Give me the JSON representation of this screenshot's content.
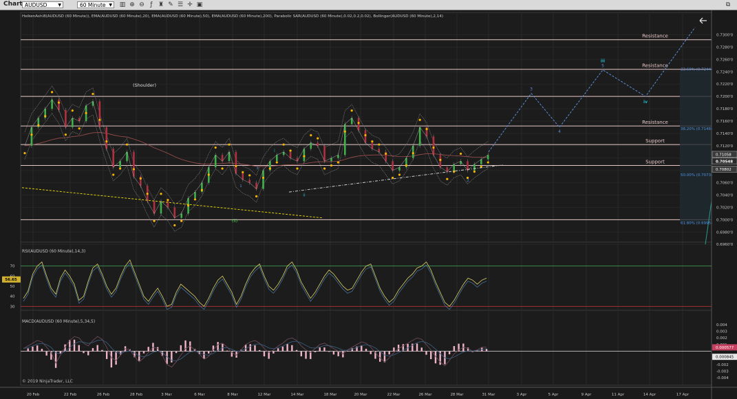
{
  "toolbar": {
    "title": "Chart",
    "instrument": "AUDUSD",
    "interval": "60 Minute"
  },
  "panels": {
    "price_header": "HeikenAshi8(AUDUSD (60 Minute)), EMA(AUDUSD (60 Minute),20), EMA(AUDUSD (60 Minute),50), EMA(AUDUSD (60 Minute),200), Parabolic SAR(AUDUSD (60 Minute),0.02,0.2,0.02), Bollinger(AUDUSD (60 Minute),2,14)",
    "rsi_header": "RSI(AUDUSD (60 Minute),14,3)",
    "macd_header": "MACD(AUDUSD (60 Minute),5,34,5)",
    "copyright": "© 2019 NinjaTrader, LLC"
  },
  "colors": {
    "background": "#1a1a1a",
    "horizontal_lines": "#e8c8c8",
    "sar": "#f5b400",
    "wave_projection": "#5b8fd6",
    "wave_label_cyan": "#1fb8c8",
    "fib_text": "#4f8fe0",
    "trendline_yellow": "#e0d000",
    "trendline_white": "#d0d0d0",
    "rsi_line": "#c8c060",
    "rsi_top": "#3a8a4a",
    "rsi_bottom": "#a03030",
    "macd_hist": "#f0b4c8"
  },
  "chart_data": [
    {
      "type": "line",
      "name": "price",
      "x_tick_labels": [
        "20 Feb",
        "22 Feb",
        "26 Feb",
        "28 Feb",
        "3 Mar",
        "6 Mar",
        "8 Mar",
        "12 Mar",
        "14 Mar",
        "18 Mar",
        "20 Mar",
        "22 Mar",
        "26 Mar",
        "28 Mar",
        "31 Mar",
        "3 Apr",
        "5 Apr",
        "9 Apr",
        "11 Apr",
        "14 Apr",
        "17 Apr"
      ],
      "y_tick_labels": [
        "0.7300'0",
        "0.7280'0",
        "0.7260'0",
        "0.7240'0",
        "0.7220'0",
        "0.7200'0",
        "0.7180'0",
        "0.7160'0",
        "0.7140'0",
        "0.7120'0",
        "0.7100'0",
        "0.7080'0",
        "0.7060'0",
        "0.7040'0",
        "0.7020'0",
        "0.7000'0",
        "0.6980'0",
        "0.6960'0"
      ],
      "ylim": [
        0.6948,
        0.7314
      ],
      "price_path": [
        [
          0,
          0.712
        ],
        [
          3,
          0.715
        ],
        [
          6,
          0.7165
        ],
        [
          9,
          0.718
        ],
        [
          12,
          0.7195
        ],
        [
          15,
          0.7178
        ],
        [
          18,
          0.715
        ],
        [
          21,
          0.7165
        ],
        [
          24,
          0.716
        ],
        [
          27,
          0.7185
        ],
        [
          30,
          0.7192
        ],
        [
          33,
          0.715
        ],
        [
          36,
          0.7115
        ],
        [
          39,
          0.7085
        ],
        [
          42,
          0.7095
        ],
        [
          45,
          0.711
        ],
        [
          48,
          0.707
        ],
        [
          51,
          0.7055
        ],
        [
          54,
          0.703
        ],
        [
          57,
          0.701
        ],
        [
          60,
          0.703
        ],
        [
          63,
          0.702
        ],
        [
          66,
          0.7003
        ],
        [
          69,
          0.701
        ],
        [
          72,
          0.7035
        ],
        [
          75,
          0.7045
        ],
        [
          78,
          0.706
        ],
        [
          81,
          0.7085
        ],
        [
          84,
          0.7105
        ],
        [
          87,
          0.7095
        ],
        [
          90,
          0.711
        ],
        [
          93,
          0.7075
        ],
        [
          96,
          0.7065
        ],
        [
          99,
          0.706
        ],
        [
          102,
          0.705
        ],
        [
          105,
          0.708
        ],
        [
          108,
          0.7095
        ],
        [
          111,
          0.7105
        ],
        [
          114,
          0.711
        ],
        [
          117,
          0.71
        ],
        [
          120,
          0.7095
        ],
        [
          123,
          0.7115
        ],
        [
          126,
          0.7125
        ],
        [
          129,
          0.712
        ],
        [
          132,
          0.7095
        ],
        [
          135,
          0.71
        ],
        [
          138,
          0.7105
        ],
        [
          141,
          0.7155
        ],
        [
          144,
          0.7165
        ],
        [
          147,
          0.7145
        ],
        [
          150,
          0.7125
        ],
        [
          153,
          0.7115
        ],
        [
          156,
          0.711
        ],
        [
          159,
          0.7095
        ],
        [
          162,
          0.708
        ],
        [
          165,
          0.7085
        ],
        [
          168,
          0.71
        ],
        [
          171,
          0.712
        ],
        [
          174,
          0.715
        ],
        [
          177,
          0.7135
        ],
        [
          180,
          0.7105
        ],
        [
          183,
          0.7085
        ],
        [
          186,
          0.7078
        ],
        [
          189,
          0.709
        ],
        [
          192,
          0.7095
        ],
        [
          195,
          0.708
        ],
        [
          198,
          0.709
        ],
        [
          201,
          0.7098
        ],
        [
          204,
          0.7105
        ]
      ],
      "horizontal_levels": [
        {
          "value": 0.7292,
          "label": "Resistance"
        },
        {
          "value": 0.7244,
          "label": "Resistance"
        },
        {
          "value": 0.72,
          "label": ""
        },
        {
          "value": 0.7152,
          "label": "Resistance"
        },
        {
          "value": 0.7122,
          "label": "Support"
        },
        {
          "value": 0.7088,
          "label": "Support"
        },
        {
          "value": 0.7,
          "label": ""
        }
      ],
      "fib_labels": [
        {
          "value": 0.7244,
          "text": "23.60% (0.7244)"
        },
        {
          "value": 0.7148,
          "text": "38.20% (0.7148)"
        },
        {
          "value": 0.7073,
          "text": "50.00% (0.7073)"
        },
        {
          "value": 0.6995,
          "text": "61.80% (0.6995)"
        }
      ],
      "price_badges": [
        "0.71058",
        "0.70548",
        "0.70802"
      ],
      "projection": [
        {
          "date": "31 Mar",
          "value": 0.711,
          "label": ""
        },
        {
          "date": "3 Apr",
          "value": 0.7205,
          "label": "3"
        },
        {
          "date": "5 Apr",
          "value": 0.715,
          "label": "4"
        },
        {
          "date": "11 Apr",
          "value": 0.7243,
          "label": "5"
        },
        {
          "date": "14 Apr",
          "value": 0.72,
          "label": "iv"
        },
        {
          "date": "17 Apr",
          "value": 0.7312,
          "label": ""
        }
      ],
      "annotations": [
        "(Shoulder)",
        "(ii)",
        "i",
        "ii",
        "iii",
        "iv",
        "1",
        "2",
        "3",
        "4",
        "5"
      ]
    },
    {
      "type": "line",
      "name": "RSI",
      "y_tick_labels": [
        "70",
        "60",
        "50",
        "40",
        "30"
      ],
      "levels": [
        70,
        30
      ],
      "ylim": [
        20,
        80
      ],
      "current_label": "56.65",
      "values": [
        38,
        45,
        62,
        70,
        74,
        60,
        48,
        42,
        58,
        66,
        60,
        52,
        36,
        40,
        55,
        68,
        72,
        62,
        50,
        42,
        48,
        60,
        70,
        76,
        64,
        52,
        40,
        35,
        42,
        48,
        40,
        30,
        32,
        44,
        52,
        48,
        44,
        40,
        34,
        30,
        38,
        48,
        56,
        60,
        52,
        44,
        32,
        40,
        52,
        62,
        68,
        72,
        60,
        50,
        46,
        52,
        60,
        70,
        74,
        66,
        54,
        46,
        38,
        44,
        52,
        60,
        66,
        62,
        56,
        50,
        46,
        48,
        56,
        64,
        70,
        72,
        60,
        48,
        40,
        34,
        38,
        46,
        52,
        58,
        62,
        68,
        70,
        74,
        66,
        54,
        44,
        34,
        30,
        36,
        44,
        52,
        58,
        56,
        52,
        56,
        58
      ]
    },
    {
      "type": "line",
      "name": "MACD",
      "y_tick_labels": [
        "0.004",
        "0.003",
        "0.002",
        "0.001",
        "-0.001",
        "-0.002",
        "-0.003",
        "-0.004"
      ],
      "ylim": [
        -0.0045,
        0.0045
      ],
      "current_labels": [
        "0.000577",
        "0.000845"
      ],
      "macd": [
        0.0004,
        0.0008,
        0.0012,
        0.0016,
        0.0014,
        0.0006,
        -0.0002,
        -0.0018,
        -0.0006,
        0.0006,
        0.0016,
        0.0022,
        0.002,
        0.0012,
        0.0008,
        0.0016,
        0.0022,
        0.0018,
        0.0006,
        -0.001,
        -0.0014,
        -0.0006,
        0.0004,
        0.0002,
        -0.0008,
        -0.0016,
        -0.001,
        -0.0002,
        0.0006,
        0.0004,
        -0.0006,
        -0.002,
        -0.0024,
        -0.0016,
        -0.0006,
        0.0004,
        0.0008,
        0.0002,
        -0.0004,
        -0.0012,
        -0.0008,
        0.0002,
        0.001,
        0.0012,
        0.0006,
        -0.0002,
        -0.0006,
        0.0002,
        0.001,
        0.0014,
        0.0016,
        0.0012,
        0.0004,
        -0.0002,
        0.0002,
        0.0008,
        0.0012,
        0.0018,
        0.002,
        0.0016,
        0.0008,
        0.0002,
        -0.0002,
        0.0004,
        0.001,
        0.0012,
        0.0008,
        0.0004,
        0.0,
        -0.0004,
        0.0002,
        0.0006,
        0.001,
        0.0014,
        0.0012,
        0.0006,
        -0.0002,
        -0.001,
        -0.0016,
        -0.001,
        -0.0002,
        0.0004,
        0.0008,
        0.0012,
        0.0016,
        0.002,
        0.0018,
        0.001,
        0.0002,
        -0.0008,
        -0.0016,
        -0.0022,
        -0.0014,
        -0.0004,
        0.0002,
        0.0006,
        0.0004,
        0.0,
        0.0002,
        0.0006,
        0.0006
      ]
    }
  ]
}
